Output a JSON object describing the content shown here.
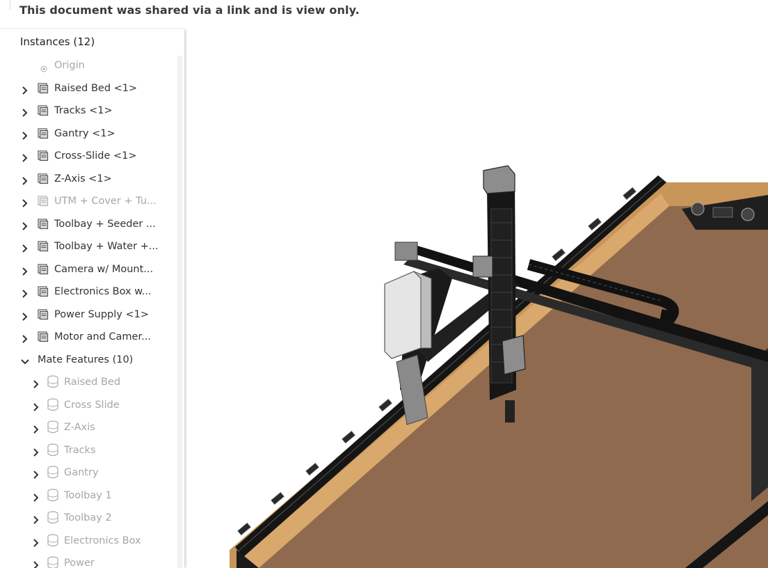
{
  "banner": {
    "text": "This document was shared via a link and is view only."
  },
  "panel": {
    "header": "Instances (12)",
    "origin": "Origin",
    "instances": [
      {
        "label": "Raised Bed <1>",
        "dim": false
      },
      {
        "label": "Tracks <1>",
        "dim": false
      },
      {
        "label": "Gantry <1>",
        "dim": false
      },
      {
        "label": "Cross-Slide <1>",
        "dim": false
      },
      {
        "label": "Z-Axis <1>",
        "dim": false
      },
      {
        "label": "UTM + Cover + Tu...",
        "dim": true
      },
      {
        "label": "Toolbay + Seeder ...",
        "dim": false
      },
      {
        "label": "Toolbay + Water +...",
        "dim": false
      },
      {
        "label": "Camera w/ Mount...",
        "dim": false
      },
      {
        "label": "Electronics Box w...",
        "dim": false
      },
      {
        "label": "Power Supply <1>",
        "dim": false
      },
      {
        "label": "Motor and Camer...",
        "dim": false
      }
    ],
    "mate_features": {
      "label": "Mate Features (10)",
      "items": [
        "Raised Bed",
        "Cross Slide",
        "Z-Axis",
        "Tracks",
        "Gantry",
        "Toolbay 1",
        "Toolbay 2",
        "Electronics Box",
        "Power"
      ]
    }
  },
  "colors": {
    "bed_surface": "#8f6a4e",
    "bed_frame": "#c9965a",
    "rail": "#1a1a1a",
    "text_dim": "#a6a6a6"
  },
  "icons": {
    "instance": "part-icon",
    "mate": "mate-connector-icon",
    "expand": "chevron-right-icon",
    "collapse": "chevron-down-icon",
    "origin": "origin-icon"
  }
}
